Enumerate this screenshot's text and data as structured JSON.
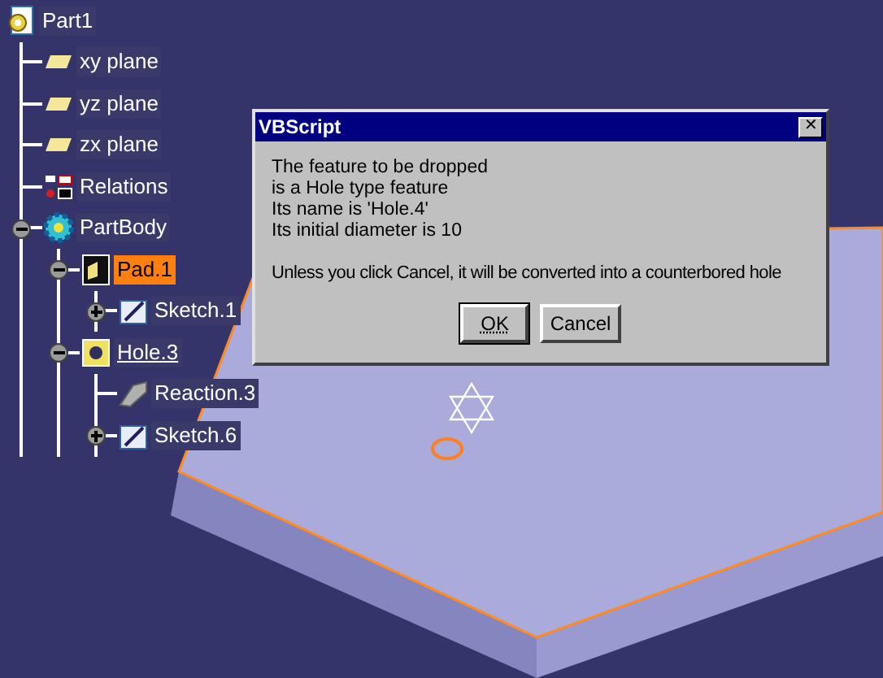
{
  "tree": {
    "label": "Part1",
    "kind": "part",
    "selected": false,
    "current": false,
    "children": [
      {
        "label": "xy plane",
        "kind": "plane",
        "selected": false,
        "current": false
      },
      {
        "label": "yz plane",
        "kind": "plane",
        "selected": false,
        "current": false
      },
      {
        "label": "zx plane",
        "kind": "plane",
        "selected": false,
        "current": false
      },
      {
        "label": "Relations",
        "kind": "relations",
        "selected": false,
        "current": false
      },
      {
        "label": "PartBody",
        "kind": "body",
        "selected": false,
        "current": false,
        "expanded": true,
        "children": [
          {
            "label": "Pad.1",
            "kind": "pad",
            "selected": true,
            "current": false,
            "expanded": true,
            "children": [
              {
                "label": "Sketch.1",
                "kind": "sketch",
                "selected": false,
                "current": false,
                "expanded": false
              }
            ]
          },
          {
            "label": "Hole.3",
            "kind": "hole",
            "selected": false,
            "current": true,
            "expanded": true,
            "children": [
              {
                "label": "Reaction.3",
                "kind": "reaction",
                "selected": false,
                "current": false
              },
              {
                "label": "Sketch.6",
                "kind": "sketch",
                "selected": false,
                "current": false,
                "expanded": false
              }
            ]
          }
        ]
      }
    ]
  },
  "dialog": {
    "title": "VBScript",
    "close": "✕",
    "lines": [
      "The feature to be dropped",
      "is a Hole type feature",
      "Its name is 'Hole.4'",
      "Its initial diameter is 10"
    ],
    "message": "Unless you click Cancel, it will be converted into a counterbored hole",
    "buttons": [
      {
        "label": "OK",
        "focused": true
      },
      {
        "label": "Cancel",
        "focused": false
      }
    ]
  }
}
